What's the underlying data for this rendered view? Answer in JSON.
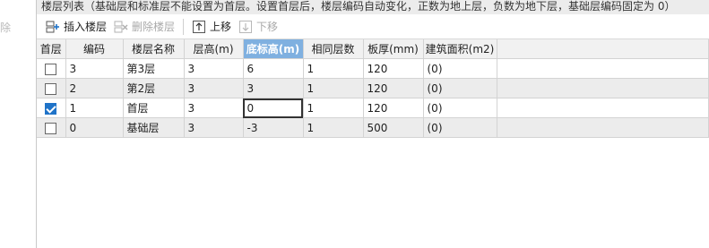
{
  "left_panel": {
    "delete_label": "除"
  },
  "title": "楼层列表（基础层和标准层不能设置为首层。设置首层后，楼层编码自动变化，正数为地上层，负数为地下层，基础层编码固定为 0）",
  "toolbar": {
    "insert_label": "插入楼层",
    "delete_label": "删除楼层",
    "up_label": "上移",
    "down_label": "下移"
  },
  "columns": [
    "首层",
    "编码",
    "楼层名称",
    "层高(m)",
    "底标高(m)",
    "相同层数",
    "板厚(mm)",
    "建筑面积(m2)"
  ],
  "active_column": "底标高(m)",
  "rows": [
    {
      "first": false,
      "code": "3",
      "name": "第3层",
      "height": "3",
      "bottom": "6",
      "same": "1",
      "thickness": "120",
      "area": "(0)"
    },
    {
      "first": false,
      "code": "2",
      "name": "第2层",
      "height": "3",
      "bottom": "3",
      "same": "1",
      "thickness": "120",
      "area": "(0)"
    },
    {
      "first": true,
      "code": "1",
      "name": "首层",
      "height": "3",
      "bottom": "0",
      "same": "1",
      "thickness": "120",
      "area": "(0)"
    },
    {
      "first": false,
      "code": "0",
      "name": "基础层",
      "height": "3",
      "bottom": "-3",
      "same": "1",
      "thickness": "500",
      "area": "(0)"
    }
  ],
  "colors": {
    "active_header": "#7fb0e0",
    "checkbox_on": "#1f73c8",
    "alt_row": "#ececec"
  }
}
